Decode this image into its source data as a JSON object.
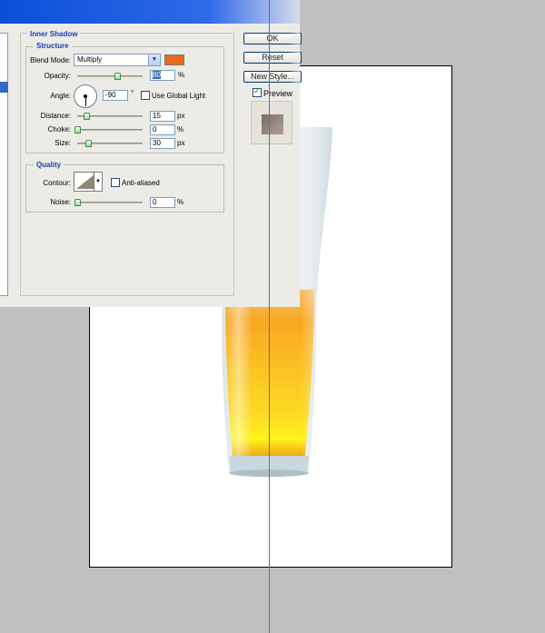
{
  "dialog": {
    "section_title": "Inner Shadow",
    "structure": {
      "title": "Structure",
      "blend_mode_label": "Blend Mode:",
      "blend_mode_value": "Multiply",
      "color": "#e8691d",
      "opacity_label": "Opacity:",
      "opacity_value": "80",
      "opacity_fraction": 0.8,
      "percent": "%",
      "angle_label": "Angle:",
      "angle_value": "-90",
      "degree": "°",
      "use_global_light_label": "Use Global Light",
      "use_global_light_checked": false,
      "distance_label": "Distance:",
      "distance_value": "15",
      "choke_label": "Choke:",
      "choke_value": "0",
      "size_label": "Size:",
      "size_value": "30",
      "px": "px"
    },
    "quality": {
      "title": "Quality",
      "contour_label": "Contour:",
      "anti_aliased_label": "Anti-aliased",
      "anti_aliased_checked": false,
      "noise_label": "Noise:",
      "noise_value": "0",
      "percent": "%"
    },
    "buttons": {
      "ok": "OK",
      "reset": "Reset",
      "new_style": "New Style...",
      "preview": "Preview",
      "preview_checked": true
    }
  }
}
